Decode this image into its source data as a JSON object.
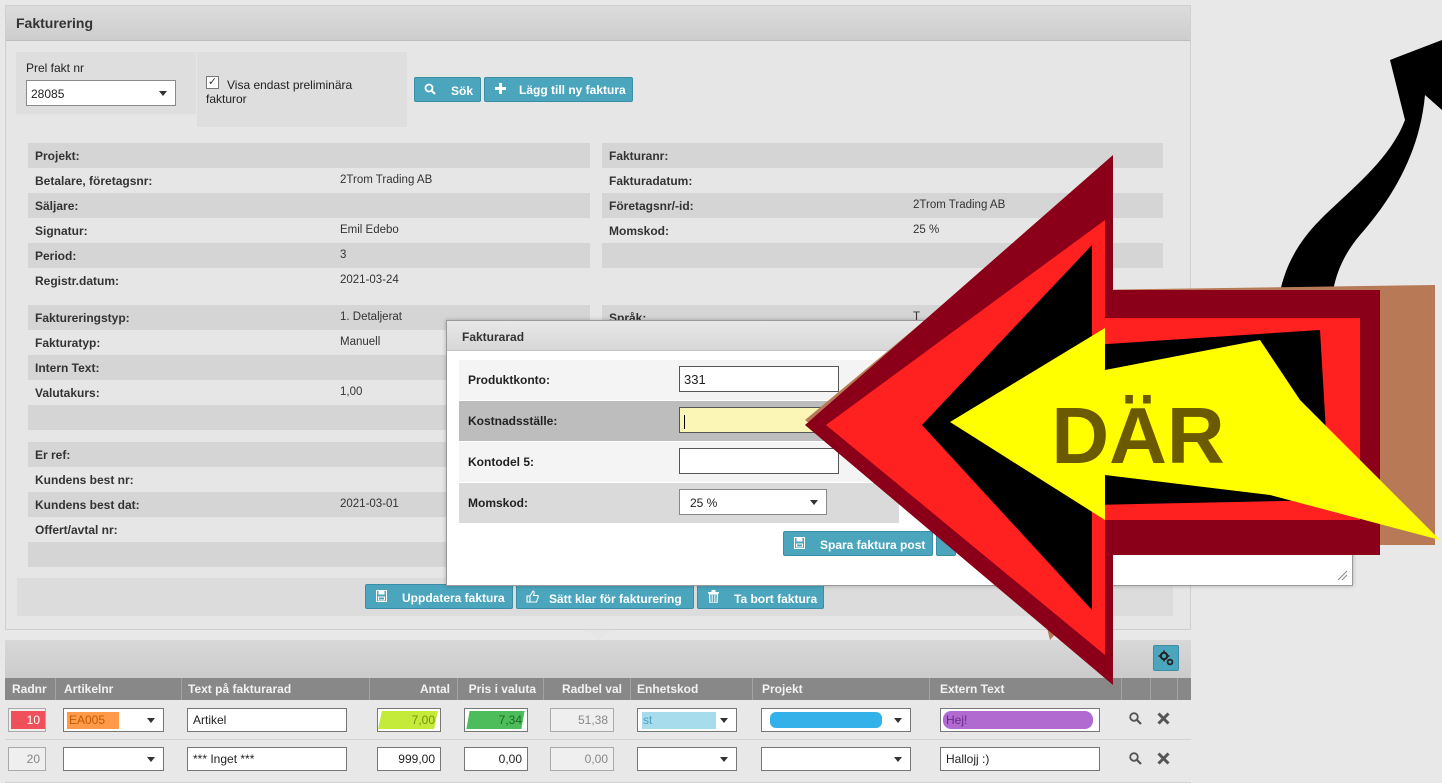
{
  "panel": {
    "title": "Fakturering",
    "prel_label": "Prel fakt nr",
    "prel_value": "28085",
    "checkbox_mark": "✓",
    "checkbox_label": "Visa endast preliminära fakturor",
    "search_button": "Sök",
    "add_button": "Lägg till ny faktura"
  },
  "left_block1": [
    {
      "k": "Projekt:",
      "v": ""
    },
    {
      "k": "Betalare, företagsnr:",
      "v": "2Trom Trading AB"
    },
    {
      "k": "Säljare:",
      "v": ""
    },
    {
      "k": "Signatur:",
      "v": "Emil Edebo"
    },
    {
      "k": "Period:",
      "v": "3"
    },
    {
      "k": "Registr.datum:",
      "v": "2021-03-24"
    }
  ],
  "right_block1": [
    {
      "k": "Fakturanr:",
      "v": ""
    },
    {
      "k": "Fakturadatum:",
      "v": ""
    },
    {
      "k": "Företagsnr/-id:",
      "v": "2Trom Trading AB"
    },
    {
      "k": "Momskod:",
      "v": "25 %"
    }
  ],
  "left_block2": [
    {
      "k": "Faktureringstyp:",
      "v": "1. Detaljerat"
    },
    {
      "k": "Fakturatyp:",
      "v": "Manuell"
    },
    {
      "k": "Intern Text:",
      "v": ""
    },
    {
      "k": "Valutakurs:",
      "v": "1,00"
    }
  ],
  "right_block2": [
    {
      "k": "Språk:",
      "v": "T"
    }
  ],
  "left_block3": [
    {
      "k": "Er ref:",
      "v": ""
    },
    {
      "k": "Kundens best nr:",
      "v": ""
    },
    {
      "k": "Kundens best dat:",
      "v": "2021-03-01"
    },
    {
      "k": "Offert/avtal nr:",
      "v": ""
    }
  ],
  "actions": {
    "update": "Uppdatera faktura",
    "ready": "Sätt klar för fakturering",
    "delete": "Ta bort faktura"
  },
  "grid": {
    "columns": [
      "Radnr",
      "Artikelnr",
      "Text på fakturarad",
      "Antal",
      "Pris i valuta",
      "Radbel val",
      "Enhetskod",
      "Projekt",
      "Extern Text"
    ],
    "rows": [
      {
        "radnr": "10",
        "artikelnr": "EA005",
        "text": "Artikel",
        "antal": "7,00",
        "pris": "7,34",
        "radbel": "51,38",
        "enhet": "st",
        "projekt": "",
        "extern": "Hej!"
      },
      {
        "radnr": "20",
        "artikelnr": "",
        "text": "*** Inget ***",
        "antal": "999,00",
        "pris": "0,00",
        "radbel": "0,00",
        "enhet": "",
        "projekt": "",
        "extern": "Hallojj :)"
      }
    ]
  },
  "dialog": {
    "title": "Fakturarad",
    "fields": [
      {
        "k": "Produktkonto:",
        "v": "331"
      },
      {
        "k": "Kostnadsställe:",
        "v": ""
      },
      {
        "k": "Kontodel 5:",
        "v": ""
      },
      {
        "k": "Momskod:",
        "v": "25 %"
      }
    ],
    "save_button": "Spara faktura post"
  },
  "annotation": {
    "text": "DÄR",
    "colors": {
      "outer": "#8b0018",
      "red": "#ff2020",
      "black": "#000000",
      "yellow": "#ffff00",
      "brown": "#b87a56",
      "text": "#6b5a00"
    }
  },
  "colors": {
    "accent": "#4aa5bd",
    "header_grey": "#888888"
  }
}
